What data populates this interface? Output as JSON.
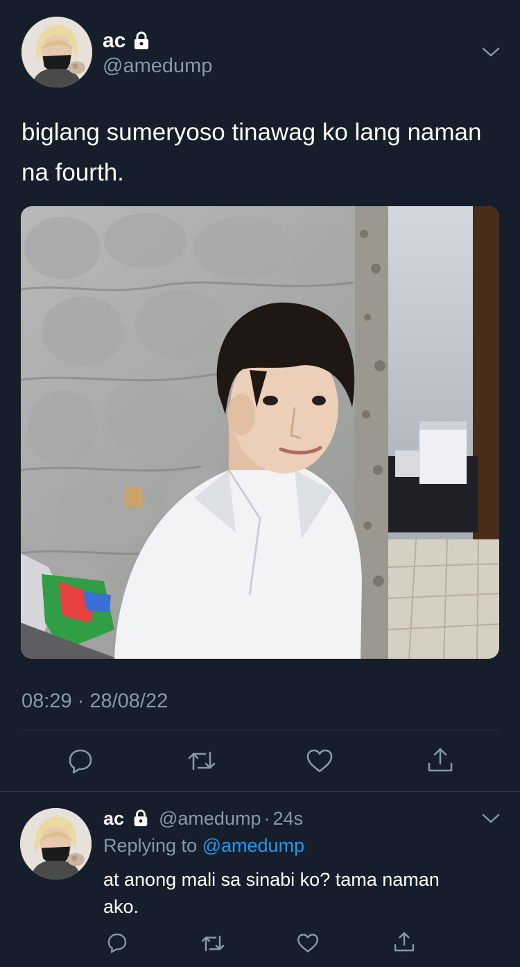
{
  "tweet": {
    "author": {
      "display_name": "ac",
      "handle": "@amedump",
      "protected_icon": "lock-icon"
    },
    "text": "biglang sumeryoso tinawag ko lang naman na fourth.",
    "timestamp": "08:29 · 28/08/22",
    "actions": [
      "reply-icon",
      "retweet-icon",
      "like-icon",
      "share-icon"
    ]
  },
  "reply": {
    "author": {
      "display_name": "ac",
      "handle": "@amedump",
      "protected_icon": "lock-icon"
    },
    "time_separator": "·",
    "time_ago": "24s",
    "replying_prefix": "Replying to",
    "replying_to": "@amedump",
    "text": "at anong mali sa sinabi ko? tama naman ako.",
    "actions": [
      "reply-icon",
      "retweet-icon",
      "like-icon",
      "share-icon"
    ]
  },
  "colors": {
    "background": "#151e2a",
    "text": "#ffffff",
    "muted": "#8899a6",
    "link": "#1d9bf0",
    "divider": "#2f3b47"
  }
}
